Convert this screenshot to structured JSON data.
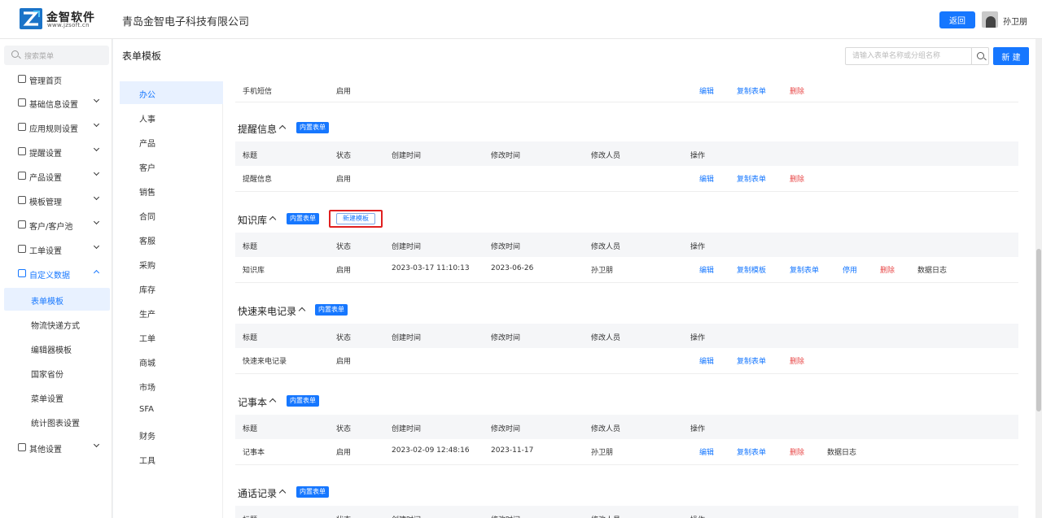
{
  "header": {
    "logo_name": "金智软件",
    "logo_url": "www.jzsoft.cn",
    "company": "青岛金智电子科技有限公司",
    "back_label": "返回",
    "user_name": "孙卫朋"
  },
  "sidebar": {
    "search_placeholder": "搜索菜单",
    "items": [
      {
        "label": "管理首页",
        "icon": "home-icon"
      },
      {
        "label": "基础信息设置",
        "icon": "cube-icon"
      },
      {
        "label": "应用规则设置",
        "icon": "file-icon"
      },
      {
        "label": "提醒设置",
        "icon": "bell-icon"
      },
      {
        "label": "产品设置",
        "icon": "cube-icon"
      },
      {
        "label": "模板管理",
        "icon": "template-icon"
      },
      {
        "label": "客户/客户池",
        "icon": "user-icon"
      },
      {
        "label": "工单设置",
        "icon": "ticket-icon"
      },
      {
        "label": "自定义数据",
        "icon": "scissors-icon"
      },
      {
        "label": "其他设置",
        "icon": "grid-icon"
      }
    ],
    "sub_items": [
      "表单模板",
      "物流快递方式",
      "编辑器模板",
      "国家省份",
      "菜单设置",
      "统计图表设置"
    ]
  },
  "main": {
    "title": "表单模板",
    "search_placeholder": "请输入表单名称或分组名称",
    "new_label": "新 建"
  },
  "categories": [
    "办公",
    "人事",
    "产品",
    "客户",
    "销售",
    "合同",
    "客服",
    "采购",
    "库存",
    "生产",
    "工单",
    "商城",
    "市场",
    "SFA",
    "财务",
    "工具"
  ],
  "columns": [
    "标题",
    "状态",
    "创建时间",
    "修改时间",
    "修改人员",
    "操作"
  ],
  "builtin_badge": "内置表单",
  "new_template_label": "新建模板",
  "top_row": {
    "title": "手机短信",
    "status": "启用",
    "actions": [
      "编辑",
      "复制表单",
      "删除"
    ]
  },
  "sections": [
    {
      "title": "提醒信息",
      "row": {
        "title": "提醒信息",
        "status": "启用",
        "created": "",
        "modified": "",
        "modifier": "",
        "actions": [
          "编辑",
          "复制表单",
          "删除"
        ]
      }
    },
    {
      "title": "知识库",
      "row": {
        "title": "知识库",
        "status": "启用",
        "created": "2023-03-17 11:10:13",
        "modified": "2023-06-26",
        "modifier": "孙卫朋",
        "actions": [
          "编辑",
          "复制模板",
          "复制表单",
          "停用",
          "删除",
          "数据日志"
        ]
      }
    },
    {
      "title": "快速来电记录",
      "row": {
        "title": "快速来电记录",
        "status": "启用",
        "created": "",
        "modified": "",
        "modifier": "",
        "actions": [
          "编辑",
          "复制表单",
          "删除"
        ]
      }
    },
    {
      "title": "记事本",
      "row": {
        "title": "记事本",
        "status": "启用",
        "created": "2023-02-09 12:48:16",
        "modified": "2023-11-17",
        "modifier": "孙卫朋",
        "actions": [
          "编辑",
          "复制表单",
          "删除",
          "数据日志"
        ]
      }
    },
    {
      "title": "通话记录"
    }
  ]
}
